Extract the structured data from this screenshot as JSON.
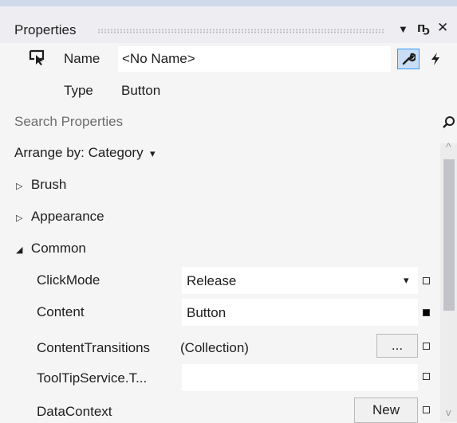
{
  "panel": {
    "title": "Properties",
    "dropdown_glyph": "▼",
    "pin_glyph": "⎕",
    "close_glyph": "✕"
  },
  "header": {
    "name_label": "Name",
    "name_value": "<No Name>",
    "type_label": "Type",
    "type_value": "Button",
    "properties_glyph": "🔧",
    "events_glyph": "⚡"
  },
  "search": {
    "placeholder": "Search Properties",
    "search_glyph": "⌕"
  },
  "arrange": {
    "label": "Arrange by: Category",
    "arrow": "▾"
  },
  "categories": [
    {
      "name": "Brush",
      "arrow": "▷"
    },
    {
      "name": "Appearance",
      "arrow": "▷"
    },
    {
      "name": "Common",
      "arrow": "◢"
    }
  ],
  "properties": [
    {
      "name": "ClickMode",
      "value": "Release",
      "control": "dropdown",
      "control_label": "▾",
      "marker": "empty"
    },
    {
      "name": "Content",
      "value": "Button",
      "control": "none",
      "control_label": "",
      "marker": "filled"
    },
    {
      "name": "ContentTransitions",
      "value": "(Collection)",
      "control": "button",
      "control_label": "...",
      "marker": "empty"
    },
    {
      "name": "ToolTipService.T...",
      "value": "",
      "control": "none",
      "control_label": "",
      "marker": "empty"
    },
    {
      "name": "DataContext",
      "value": "",
      "control": "button",
      "control_label": "New",
      "marker": "empty"
    }
  ],
  "scrollbar": {
    "up_arrow": "^",
    "down_arrow": "v"
  },
  "colors": {
    "accent": "#3399ff",
    "selected_bg": "#c9def5",
    "panel_bg": "#f5f5f5",
    "title_bg": "#eeeef2"
  }
}
